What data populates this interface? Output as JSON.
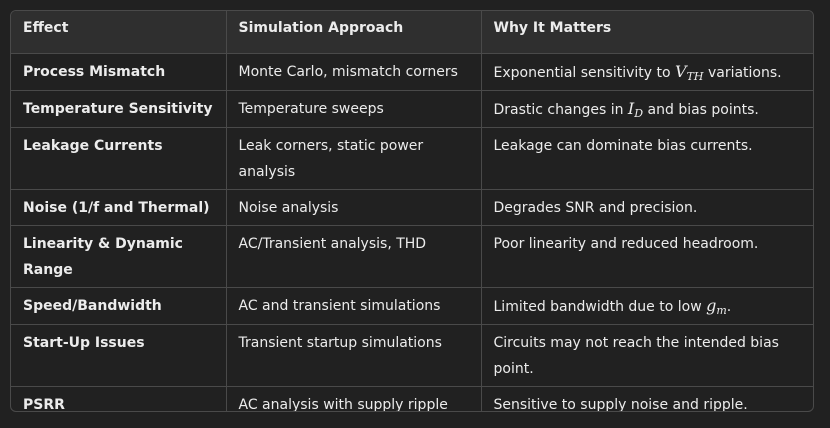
{
  "table": {
    "headers": [
      "Effect",
      "Simulation Approach",
      "Why It Matters"
    ],
    "rows": [
      {
        "effect": "Process Mismatch",
        "approach": "Monte Carlo, mismatch corners",
        "why_pre": "Exponential sensitivity to ",
        "why_math": "V",
        "why_sub": "TH",
        "why_post": " variations."
      },
      {
        "effect": "Temperature Sensitivity",
        "approach": "Temperature sweeps",
        "why_pre": "Drastic changes in ",
        "why_math": "I",
        "why_sub": "D",
        "why_post": " and bias points."
      },
      {
        "effect": "Leakage Currents",
        "approach": "Leak corners, static power analysis",
        "why": "Leakage can dominate bias currents."
      },
      {
        "effect": "Noise (1/f and Thermal)",
        "approach": "Noise analysis",
        "why": "Degrades SNR and precision."
      },
      {
        "effect": "Linearity & Dynamic Range",
        "approach": "AC/Transient analysis, THD",
        "why": "Poor linearity and reduced headroom."
      },
      {
        "effect": "Speed/Bandwidth",
        "approach": "AC and transient simulations",
        "why_pre": "Limited bandwidth due to low ",
        "why_math": "g",
        "why_sub": "m",
        "why_post": "."
      },
      {
        "effect": "Start-Up Issues",
        "approach": "Transient startup simulations",
        "why": "Circuits may not reach the intended bias point."
      },
      {
        "effect": "PSRR",
        "approach": "AC analysis with supply ripple",
        "why": "Sensitive to supply noise and ripple."
      }
    ]
  }
}
